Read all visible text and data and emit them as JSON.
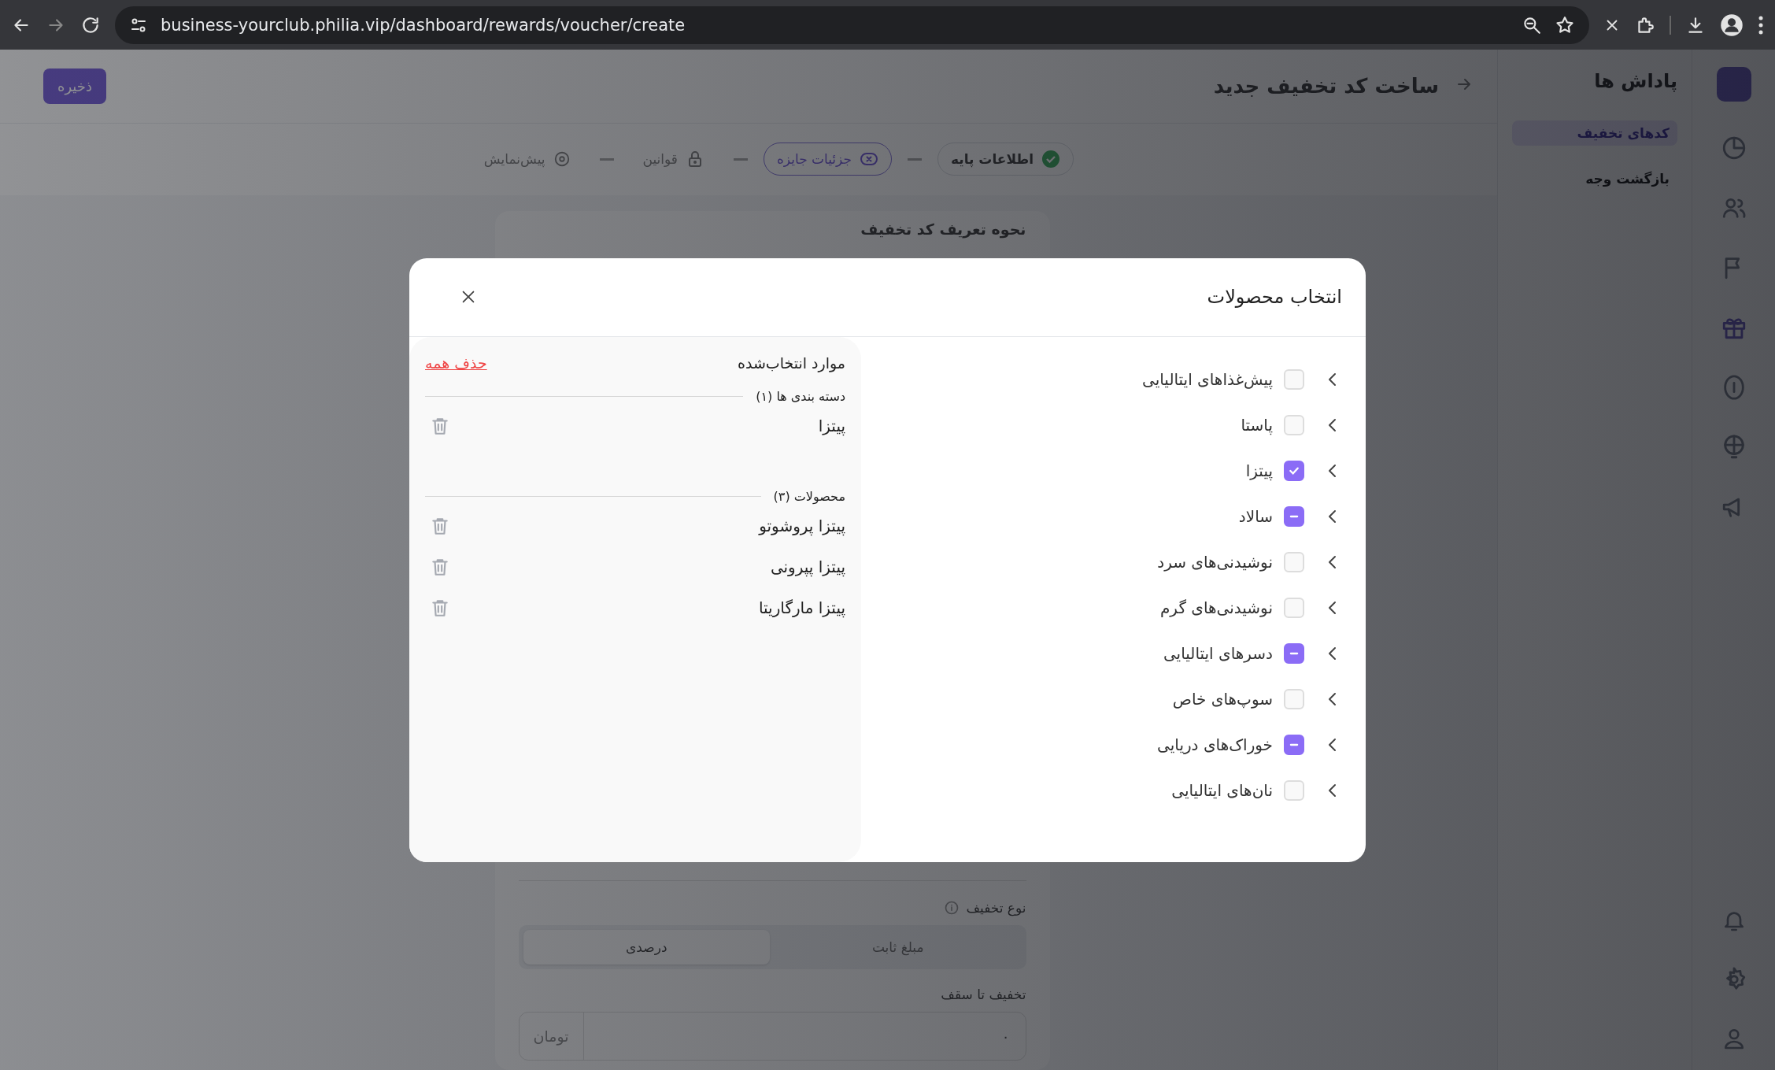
{
  "browser": {
    "url": "business-yourclub.philia.vip/dashboard/rewards/voucher/create"
  },
  "sidebar": {
    "title": "پاداش ها",
    "items": [
      {
        "label": "کدهای تخفیف",
        "selected": true
      },
      {
        "label": "بازگشت وجه",
        "selected": false
      }
    ]
  },
  "header": {
    "title": "ساخت کد تخفیف جدید",
    "save_button": "ذخیره"
  },
  "stepper": [
    {
      "label": "اطلاعات پایه",
      "completed": true,
      "selected": false,
      "locked": false
    },
    {
      "label": "جزئیات جایزه",
      "completed": false,
      "selected": true,
      "locked": false
    },
    {
      "label": "قوانین",
      "completed": false,
      "selected": false,
      "locked": true
    },
    {
      "label": "پیش‌نمایش",
      "completed": false,
      "selected": false,
      "locked": false
    }
  ],
  "form": {
    "section_title": "نحوه تعریف کد تخفیف",
    "discount_type_label": "نوع تخفیف",
    "discount_types": [
      {
        "label": "مبلغ ثابت",
        "selected": false
      },
      {
        "label": "درصدی",
        "selected": true
      }
    ],
    "cap_label": "تخفیف تا سقف",
    "cap_value": "۰",
    "cap_unit": "تومان"
  },
  "modal": {
    "title": "انتخاب محصولات",
    "categories": [
      {
        "label": "پیش‌غذاهای ایتالیایی",
        "checked": false,
        "indeterminate": false
      },
      {
        "label": "پاستا",
        "checked": false,
        "indeterminate": false
      },
      {
        "label": "پیتزا",
        "checked": true,
        "indeterminate": false
      },
      {
        "label": "سالاد",
        "checked": false,
        "indeterminate": true
      },
      {
        "label": "نوشیدنی‌های سرد",
        "checked": false,
        "indeterminate": false
      },
      {
        "label": "نوشیدنی‌های گرم",
        "checked": false,
        "indeterminate": false
      },
      {
        "label": "دسرهای ایتالیایی",
        "checked": false,
        "indeterminate": true
      },
      {
        "label": "سوپ‌های خاص",
        "checked": false,
        "indeterminate": false
      },
      {
        "label": "خوراک‌های دریایی",
        "checked": false,
        "indeterminate": true
      },
      {
        "label": "نان‌های ایتالیایی",
        "checked": false,
        "indeterminate": false
      }
    ],
    "selected_panel": {
      "title": "موارد انتخاب‌شده",
      "clear_all": "حذف همه",
      "groups": [
        {
          "title": "دسته بندی ها (۱)",
          "items": [
            "پیتزا"
          ]
        },
        {
          "title": "محصولات (۳)",
          "items": [
            "پیتزا پروشوتو",
            "پیتزا پپرونی",
            "پیتزا مارگاریتا"
          ]
        }
      ]
    }
  }
}
